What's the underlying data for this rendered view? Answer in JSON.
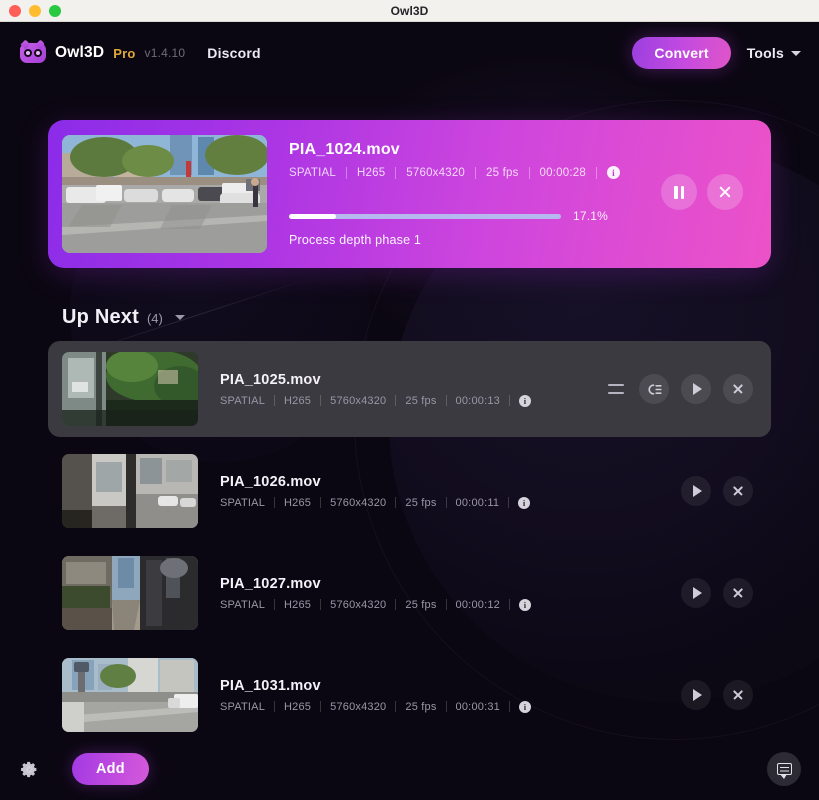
{
  "window": {
    "title": "Owl3D",
    "traffic_lights": [
      "close",
      "minimize",
      "maximize"
    ]
  },
  "header": {
    "brand_name": "Owl3D",
    "brand_tier": "Pro",
    "version": "v1.4.10",
    "nav_link": "Discord",
    "convert_label": "Convert",
    "tools_label": "Tools",
    "logo_icon": "owl-logo-icon",
    "caret_icon": "chevron-down-icon",
    "accent_gradient_start": "#9b3fe0",
    "accent_gradient_end": "#e055c8"
  },
  "active_job": {
    "title": "PIA_1024.mov",
    "meta": [
      "SPATIAL",
      "H265",
      "5760x4320",
      "25 fps",
      "00:00:28"
    ],
    "info_icon": "info-icon",
    "progress_percent_label": "17.1%",
    "progress_percent_value": 17.1,
    "progress_fill_color": "#ffffff",
    "progress_track_color": "#b6b9ef",
    "phase_text": "Process depth phase 1",
    "pause_icon": "pause-icon",
    "close_icon": "close-icon",
    "card_gradient_start": "#8b2ce8",
    "card_gradient_end": "#ec52c8",
    "thumbnail_alt": "street-with-parked-cars"
  },
  "up_next": {
    "title": "Up Next",
    "count_label": "(4)",
    "collapse_icon": "chevron-down-icon",
    "rows": [
      {
        "title": "PIA_1025.mov",
        "meta": [
          "SPATIAL",
          "H265",
          "5760x4320",
          "25 fps",
          "00:00:13"
        ],
        "selected": true,
        "thumbnail_alt": "balcony-with-plants",
        "actions": [
          "drag-handle-icon",
          "play-next-icon",
          "play-icon",
          "close-icon"
        ]
      },
      {
        "title": "PIA_1026.mov",
        "meta": [
          "SPATIAL",
          "H265",
          "5760x4320",
          "25 fps",
          "00:00:11"
        ],
        "selected": false,
        "thumbnail_alt": "covered-walkway-street",
        "actions": [
          "play-icon",
          "close-icon"
        ]
      },
      {
        "title": "PIA_1027.mov",
        "meta": [
          "SPATIAL",
          "H265",
          "5760x4320",
          "25 fps",
          "00:00:12"
        ],
        "selected": false,
        "thumbnail_alt": "city-sidewalk-arcade",
        "actions": [
          "play-icon",
          "close-icon"
        ]
      },
      {
        "title": "PIA_1031.mov",
        "meta": [
          "SPATIAL",
          "H265",
          "5760x4320",
          "25 fps",
          "00:00:31"
        ],
        "selected": false,
        "thumbnail_alt": "city-street-intersection",
        "actions": [
          "play-icon",
          "close-icon"
        ]
      }
    ]
  },
  "bottom_bar": {
    "settings_icon": "gear-icon",
    "add_label": "Add",
    "chat_icon": "chat-bubble-icon"
  }
}
